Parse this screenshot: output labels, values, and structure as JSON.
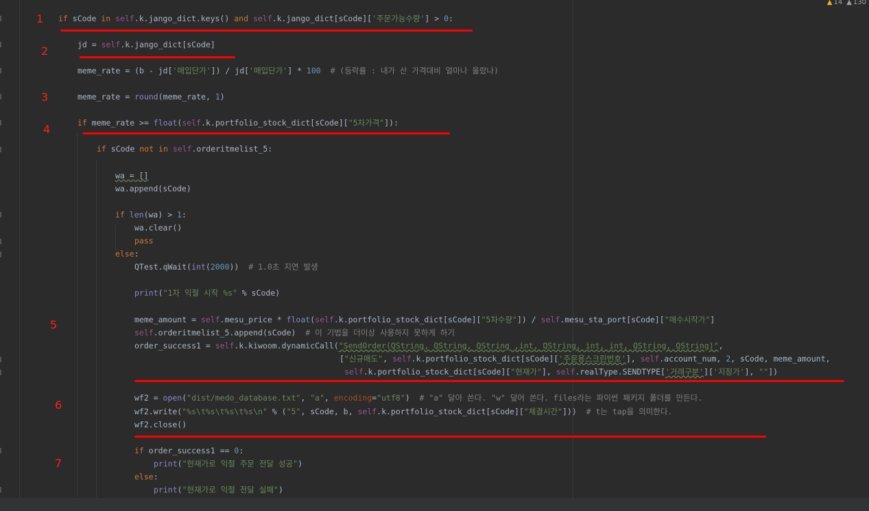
{
  "inspections": {
    "warnings_count": "14",
    "weak_warnings_count": "130"
  },
  "annotations": [
    "1",
    "2",
    "3",
    "4",
    "5",
    "6",
    "7"
  ],
  "code": {
    "l1": [
      "if",
      " sCode ",
      "in",
      " ",
      "self",
      ".k.jango_dict.keys() ",
      "and",
      " ",
      "self",
      ".k.jango_dict[sCode][",
      "'주문가능수량'",
      "] > ",
      "0",
      ":"
    ],
    "l2": [
      "jd = ",
      "self",
      ".k.jango_dict[sCode]"
    ],
    "l3": [
      "meme_rate = (b - jd[",
      "'매입단가'",
      "]) / jd[",
      "'매입단가'",
      "] * ",
      "100",
      "  ",
      "# (등락률 : 내가 산 가격대비 얼마나 올랐나)"
    ],
    "l4": [
      "meme_rate = ",
      "round",
      "(meme_rate, ",
      "1",
      ")"
    ],
    "l5": [
      "if",
      " meme_rate >= ",
      "float",
      "(",
      "self",
      ".k.portfolio_stock_dict[sCode][",
      "\"5차가격\"",
      "]):"
    ],
    "l6": [
      "if",
      " sCode ",
      "not in",
      " ",
      "self",
      ".orderitmelist_5:"
    ],
    "l7": [
      "wa = []"
    ],
    "l8": [
      "wa.append(sCode)"
    ],
    "l9": [
      "if",
      " ",
      "len",
      "(wa) > ",
      "1",
      ":"
    ],
    "l10": [
      "wa.clear()"
    ],
    "l11": [
      "pass"
    ],
    "l12": [
      "else",
      ":"
    ],
    "l13": [
      "QTest.qWait(",
      "int",
      "(",
      "2000",
      "))",
      "  ",
      "# 1.0초 지연 발생"
    ],
    "l14": [
      "print",
      "(",
      "\"1차 익절 시작 %s\"",
      " % sCode)"
    ],
    "l15": [
      "meme_amount = ",
      "self",
      ".mesu_price * ",
      "float",
      "(",
      "self",
      ".k.portfolio_stock_dict[sCode][",
      "\"5차수량\"",
      "]) / ",
      "self",
      ".mesu_sta_port[sCode][",
      "\"매수시작가\"",
      "]"
    ],
    "l16": [
      "self",
      ".orderitmelist_5.append(sCode)  ",
      "# 이 기법을 더이상 사용하지 못하게 하기"
    ],
    "l17": [
      "order_success1 = ",
      "self",
      ".k.kiwoom.dynamicCall(",
      "\"SendOrder(QString, QString, QString ,int, QString, int, int, QString, QString)\"",
      ","
    ],
    "l18": [
      "[",
      "\"신규매도\"",
      ", ",
      "self",
      ".k.portfolio_stock_dict[sCode][",
      "'주문용스크린번호'",
      "], ",
      "self",
      ".account_num, ",
      "2",
      ", sCode, meme_amount,"
    ],
    "l19": [
      "self",
      ".k.portfolio_stock_dict[sCode][",
      "\"현재가\"",
      "], ",
      "self",
      ".realType.SENDTYPE[",
      "'거래구분'",
      "][",
      "'지정가'",
      "], ",
      "\"\"",
      "])"
    ],
    "l20": [
      "wf2 = ",
      "open",
      "(",
      "\"dist/medo_database.txt\"",
      ", ",
      "\"a\"",
      ", ",
      "encoding",
      "=",
      "\"utf8\"",
      ")  ",
      "# \"a\" 달아 쓴다. \"w\" 덮어 쓴다. files라는 파이썬 패키지 폴더를 만든다."
    ],
    "l21": [
      "wf2.write(",
      "\"%s\\t%s\\t%s\\t%s\\n\"",
      " % (",
      "\"5\"",
      ", sCode, b, ",
      "self",
      ".k.portfolio_stock_dict[sCode][",
      "\"체결시간\"",
      "]))  ",
      "# t는 tap을 의미한다."
    ],
    "l22": [
      "wf2.close()"
    ],
    "l23": [
      "if",
      " order_success1 == ",
      "0",
      ":"
    ],
    "l24": [
      "print",
      "(",
      "\"현재가로 익절 주문 전달 성공\"",
      ")"
    ],
    "l25": [
      "else",
      ":"
    ],
    "l26": [
      "print",
      "(",
      "\"현재가로 익절 전달 실패\"",
      ")"
    ]
  }
}
